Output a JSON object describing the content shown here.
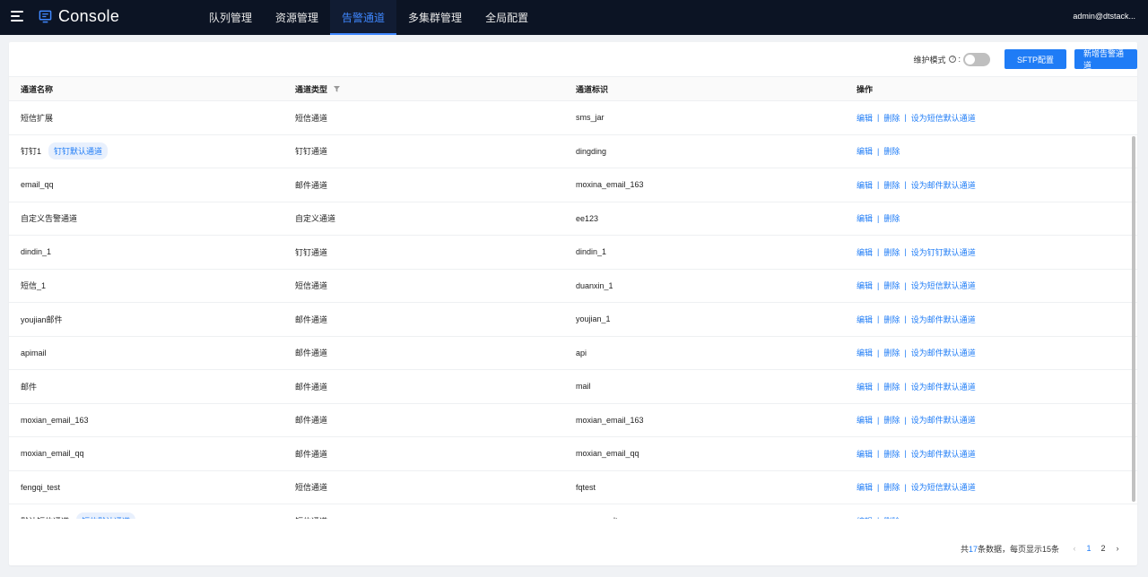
{
  "header": {
    "brand": "Console",
    "nav": [
      "队列管理",
      "资源管理",
      "告警通道",
      "多集群管理",
      "全局配置"
    ],
    "active_nav": "告警通道",
    "user": "admin@dtstack..."
  },
  "toolbar": {
    "maintenance_label": "维护模式",
    "maintenance_colon": ":",
    "maintenance_on": false,
    "sftp_button": "SFTP配置",
    "add_button": "新增告警通道"
  },
  "table": {
    "columns": [
      "通道名称",
      "通道类型",
      "通道标识",
      "操作"
    ],
    "rows": [
      {
        "name": "短信扩展",
        "tag": "",
        "type": "短信通道",
        "id": "sms_jar",
        "default_action": "设为短信默认通道"
      },
      {
        "name": "钉钉1",
        "tag": "钉钉默认通道",
        "type": "钉钉通道",
        "id": "dingding",
        "default_action": ""
      },
      {
        "name": "email_qq",
        "tag": "",
        "type": "邮件通道",
        "id": "moxina_email_163",
        "default_action": "设为邮件默认通道"
      },
      {
        "name": "自定义告警通道",
        "tag": "",
        "type": "自定义通道",
        "id": "ee123",
        "default_action": ""
      },
      {
        "name": "dindin_1",
        "tag": "",
        "type": "钉钉通道",
        "id": "dindin_1",
        "default_action": "设为钉钉默认通道"
      },
      {
        "name": "短信_1",
        "tag": "",
        "type": "短信通道",
        "id": "duanxin_1",
        "default_action": "设为短信默认通道"
      },
      {
        "name": "youjian邮件",
        "tag": "",
        "type": "邮件通道",
        "id": "youjian_1",
        "default_action": "设为邮件默认通道"
      },
      {
        "name": "apimail",
        "tag": "",
        "type": "邮件通道",
        "id": "api",
        "default_action": "设为邮件默认通道"
      },
      {
        "name": "邮件",
        "tag": "",
        "type": "邮件通道",
        "id": "mail",
        "default_action": "设为邮件默认通道"
      },
      {
        "name": "moxian_email_163",
        "tag": "",
        "type": "邮件通道",
        "id": "moxian_email_163",
        "default_action": "设为邮件默认通道"
      },
      {
        "name": "moxian_email_qq",
        "tag": "",
        "type": "邮件通道",
        "id": "moxian_email_qq",
        "default_action": "设为邮件默认通道"
      },
      {
        "name": "fengqi_test",
        "tag": "",
        "type": "短信通道",
        "id": "fqtest",
        "default_action": "设为短信默认通道"
      },
      {
        "name": "默认短信通道",
        "tag": "短信默认通道",
        "type": "短信通道",
        "id": "mr_sms_alter",
        "default_action": ""
      }
    ],
    "edit_label": "编辑",
    "delete_label": "删除",
    "separator": "|"
  },
  "pagination": {
    "prefix": "共",
    "total": "17",
    "suffix": "条数据，每页显示15条",
    "pages": [
      "1",
      "2"
    ],
    "current": "1"
  },
  "colors": {
    "accent": "#1f7cf6",
    "header_bg": "#0c1424"
  }
}
